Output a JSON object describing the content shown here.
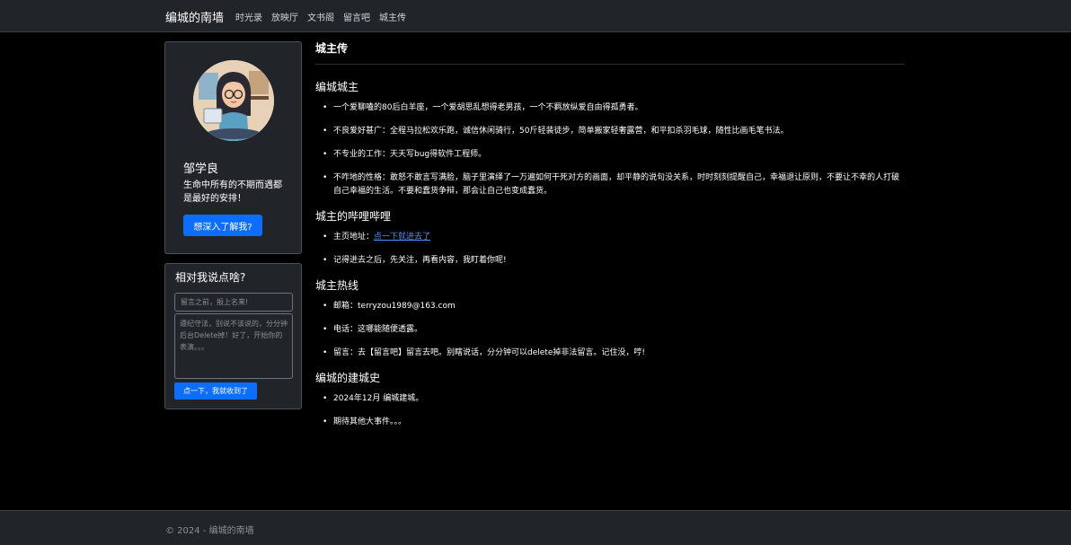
{
  "nav": {
    "brand": "编城的南墙",
    "links": [
      "时光录",
      "放映厅",
      "文书阁",
      "留言吧",
      "城主传"
    ]
  },
  "profile": {
    "name": "邹学良",
    "motto": "生命中所有的不期而遇都是最好的安排！",
    "button": "想深入了解我?"
  },
  "message": {
    "title": "相对我说点啥?",
    "name_placeholder": "留言之前，报上名来!",
    "text_placeholder": "遵纪守法，别说不该说的，分分钟后台Delete掉！好了，开始你的表演。。。",
    "submit": "点一下，我就收到了"
  },
  "page_title": "城主传",
  "sections": {
    "s1": {
      "title": "编城城主",
      "items": [
        "一个爱聊嗑的80后白羊座，一个爱胡思乱想得老男孩，一个不羁放纵爱自由得孤勇者。",
        "不良爱好甚广：全程马拉松欢乐跑，诚信休闲骑行，50斤轻装徒步，简单搬家轻奢露营，和平扣杀羽毛球，随性比画毛笔书法。",
        "不专业的工作：天天写bug得软件工程师。",
        "不咋地的性格：敢怒不敢言写满脸，脑子里演绎了一万遍如何干死对方的画面，却平静的说句没关系，时时刻刻提醒自己，幸福退让原则，不要让不幸的人打破自己幸福的生活。不要和蠢货争辩，那会让自己也变成蠢货。"
      ]
    },
    "s2": {
      "title": "城主的哔哩哔哩",
      "home_label": "主页地址：",
      "home_link": "点一下就进去了",
      "note": "记得进去之后，先关注，再看内容，我盯着你呢!"
    },
    "s3": {
      "title": "城主热线",
      "items": [
        "邮箱：terryzou1989@163.com",
        "电话：这哪能随便透露。",
        "留言：去【留言吧】留言去吧。别瞎说话，分分钟可以delete掉非法留言。记住没，哼!"
      ]
    },
    "s4": {
      "title": "编城的建城史",
      "items": [
        "2024年12月 编城建城。",
        "期待其他大事件。。。"
      ]
    }
  },
  "footer": "© 2024 - 编城的南墙"
}
